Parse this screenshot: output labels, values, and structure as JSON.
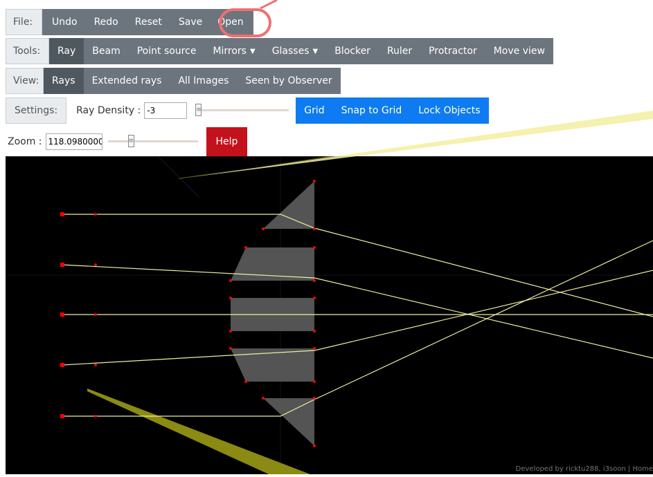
{
  "file_bar": {
    "label": "File:",
    "items": [
      {
        "label": "Undo"
      },
      {
        "label": "Redo"
      },
      {
        "label": "Reset"
      },
      {
        "label": "Save"
      },
      {
        "label": "Open"
      }
    ]
  },
  "tools_bar": {
    "label": "Tools:",
    "items": [
      {
        "label": "Ray",
        "active": true
      },
      {
        "label": "Beam"
      },
      {
        "label": "Point source"
      },
      {
        "label": "Mirrors"
      },
      {
        "label": "Glasses"
      },
      {
        "label": "Blocker"
      },
      {
        "label": "Ruler"
      },
      {
        "label": "Protractor"
      },
      {
        "label": "Move view"
      }
    ]
  },
  "view_bar": {
    "label": "View:",
    "items": [
      {
        "label": "Rays",
        "active": true
      },
      {
        "label": "Extended rays"
      },
      {
        "label": "All Images"
      },
      {
        "label": "Seen by Observer"
      }
    ]
  },
  "settings": {
    "label": "Settings:",
    "ray_density_label": "Ray Density :",
    "ray_density_value": "-3",
    "grid": "Grid",
    "snap_to_grid": "Snap to Grid",
    "lock_objects": "Lock Objects"
  },
  "zoom": {
    "label": "Zoom :",
    "value": "118.0980000"
  },
  "help": {
    "label": "Help"
  },
  "footer": {
    "credit": "Developed by ricktu288, i3soon | Home"
  },
  "colors": {
    "toolbar_bg": "#6c757d",
    "toolbar_active": "#50585f",
    "settings_blue": "#0e7bf2",
    "help_red": "#c4121d",
    "ray_yellow": "#f0f0a0",
    "handle_red": "#ff0000",
    "glass_gray": "#545454",
    "annotation_circle": "#f07070"
  }
}
